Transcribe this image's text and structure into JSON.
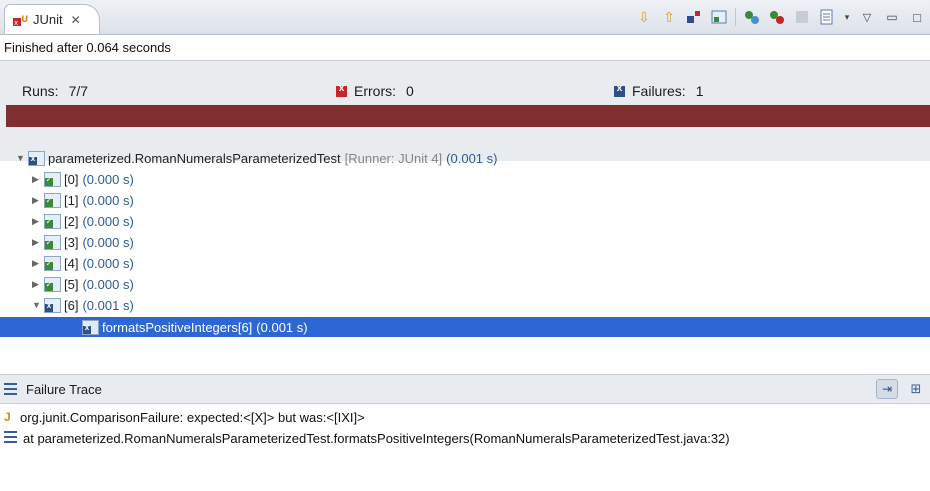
{
  "tab": {
    "title": "JUnit",
    "close_glyph": "✕"
  },
  "toolbar": {
    "icons": [
      "next-failure-icon",
      "previous-failure-icon",
      "show-failures-only-icon",
      "scroll-lock-icon",
      "rerun-test-icon",
      "rerun-failed-first-icon",
      "stop-icon",
      "test-run-history-icon",
      "view-menu-icon",
      "minimize-icon",
      "maximize-icon"
    ]
  },
  "status": {
    "finished": "Finished after 0.064 seconds"
  },
  "counters": {
    "runs_label": "Runs:",
    "runs_value": "7/7",
    "errors_label": "Errors:",
    "errors_value": "0",
    "failures_label": "Failures:",
    "failures_value": "1"
  },
  "progress": {
    "color": "#7f2f2f",
    "state": "failed"
  },
  "tree": {
    "suite": {
      "name": "parameterized.RomanNumeralsParameterizedTest",
      "runner": "[Runner: JUnit 4]",
      "time": "(0.001 s)"
    },
    "items": [
      {
        "name": "[0]",
        "time": "(0.000 s)"
      },
      {
        "name": "[1]",
        "time": "(0.000 s)"
      },
      {
        "name": "[2]",
        "time": "(0.000 s)"
      },
      {
        "name": "[3]",
        "time": "(0.000 s)"
      },
      {
        "name": "[4]",
        "time": "(0.000 s)"
      },
      {
        "name": "[5]",
        "time": "(0.000 s)"
      },
      {
        "name": "[6]",
        "time": "(0.001 s)"
      }
    ],
    "selected": {
      "name": "formatsPositiveIntegers[6]",
      "time": "(0.001 s)"
    }
  },
  "trace": {
    "title": "Failure Trace",
    "lines": [
      "org.junit.ComparisonFailure: expected:<[X]> but was:<[IXI]>",
      "at parameterized.RomanNumeralsParameterizedTest.formatsPositiveIntegers(RomanNumeralsParameterizedTest.java:32)"
    ]
  }
}
